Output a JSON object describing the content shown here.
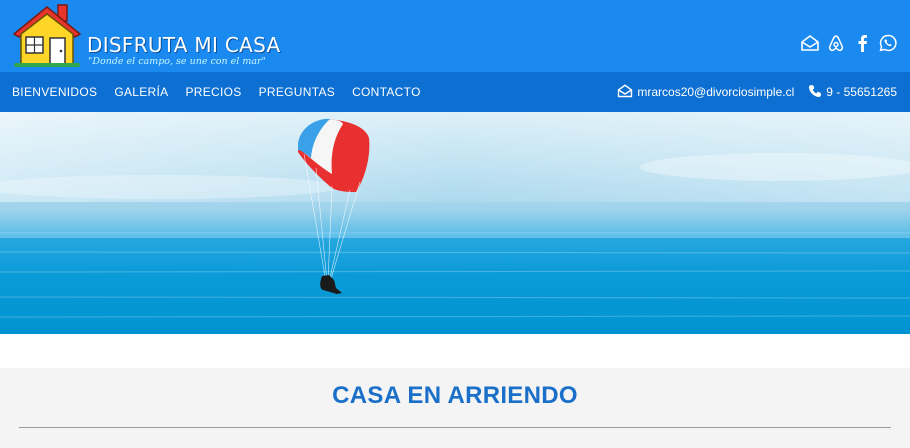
{
  "brand": {
    "title": "DISFRUTA MI CASA",
    "tagline": "\"Donde el campo, se une con el mar\""
  },
  "social": [
    {
      "name": "email-icon"
    },
    {
      "name": "airbnb-icon"
    },
    {
      "name": "facebook-icon"
    },
    {
      "name": "whatsapp-icon"
    }
  ],
  "nav": {
    "items": [
      {
        "label": "BIENVENIDOS"
      },
      {
        "label": "GALERÍA"
      },
      {
        "label": "PRECIOS"
      },
      {
        "label": "PREGUNTAS"
      },
      {
        "label": "CONTACTO"
      }
    ]
  },
  "contact": {
    "email": "mrarcos20@divorciosimple.cl",
    "phone": "9 - 55651265"
  },
  "section": {
    "title": "CASA EN ARRIENDO"
  },
  "colors": {
    "topbar": "#1a8af0",
    "navbar": "#0c6fd1",
    "section_title": "#1a6fc9"
  }
}
